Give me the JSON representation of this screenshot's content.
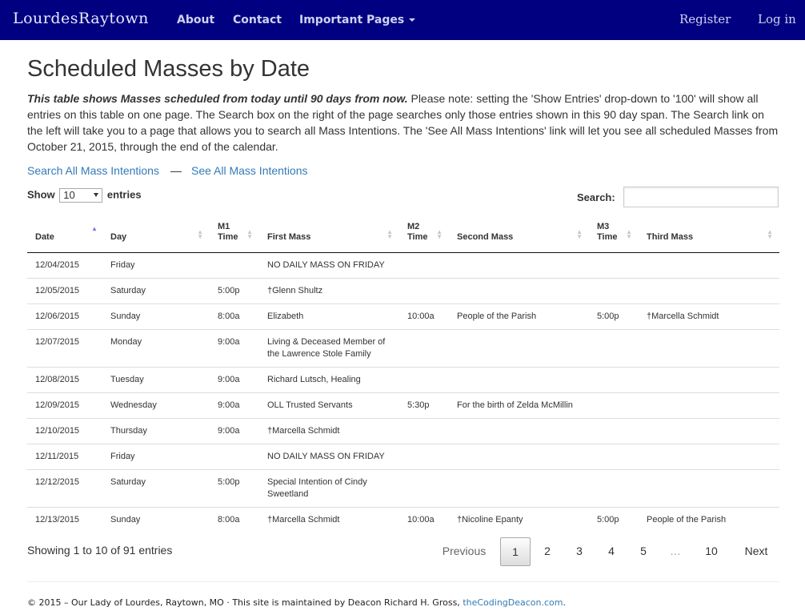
{
  "nav": {
    "brand": "LourdesRaytown",
    "about": "About",
    "contact": "Contact",
    "important": "Important Pages",
    "register": "Register",
    "login": "Log in"
  },
  "page": {
    "title": "Scheduled Masses by Date",
    "intro_bold": "This table shows Masses scheduled from today until 90 days from now.",
    "intro_rest": " Please note: setting the 'Show Entries' drop-down to '100' will show all entries on this table on one page. The Search box on the right of the page searches only those entries shown in this 90 day span. The Search link on the left will take you to a page that allows you to search all Mass Intentions. The 'See All Mass Intentions' link will let you see all scheduled Masses from October 21, 2015, through the end of the calendar.",
    "link_search": "Search All Mass Intentions",
    "link_sep": "—",
    "link_all": "See All Mass Intentions"
  },
  "controls": {
    "show_label": "Show",
    "show_value": "10",
    "entries_label": "entries",
    "search_label": "Search:"
  },
  "table": {
    "headers": {
      "date": "Date",
      "day": "Day",
      "m1": "M1",
      "m1time": "Time",
      "first": "First Mass",
      "m2": "M2",
      "m2time": "Time",
      "second": "Second Mass",
      "m3": "M3",
      "m3time": "Time",
      "third": "Third Mass"
    },
    "rows": [
      [
        "12/04/2015",
        "Friday",
        "",
        "NO DAILY MASS ON FRIDAY",
        "",
        "",
        "",
        ""
      ],
      [
        "12/05/2015",
        "Saturday",
        "5:00p",
        "†Glenn Shultz",
        "",
        "",
        "",
        ""
      ],
      [
        "12/06/2015",
        "Sunday",
        "8:00a",
        "Elizabeth",
        "10:00a",
        "People of the Parish",
        "5:00p",
        "†Marcella Schmidt"
      ],
      [
        "12/07/2015",
        "Monday",
        "9:00a",
        "Living & Deceased Member of the Lawrence Stole Family",
        "",
        "",
        "",
        ""
      ],
      [
        "12/08/2015",
        "Tuesday",
        "9:00a",
        "Richard Lutsch, Healing",
        "",
        "",
        "",
        ""
      ],
      [
        "12/09/2015",
        "Wednesday",
        "9:00a",
        "OLL Trusted Servants",
        "5:30p",
        "For the birth of Zelda McMillin",
        "",
        ""
      ],
      [
        "12/10/2015",
        "Thursday",
        "9:00a",
        "†Marcella Schmidt",
        "",
        "",
        "",
        ""
      ],
      [
        "12/11/2015",
        "Friday",
        "",
        "NO DAILY MASS ON FRIDAY",
        "",
        "",
        "",
        ""
      ],
      [
        "12/12/2015",
        "Saturday",
        "5:00p",
        "Special Intention of Cindy Sweetland",
        "",
        "",
        "",
        ""
      ],
      [
        "12/13/2015",
        "Sunday",
        "8:00a",
        "†Marcella Schmidt",
        "10:00a",
        "†Nicoline Epanty",
        "5:00p",
        "People of the Parish"
      ]
    ]
  },
  "pagination": {
    "info": "Showing 1 to 10 of 91 entries",
    "previous": "Previous",
    "pages": [
      "1",
      "2",
      "3",
      "4",
      "5"
    ],
    "ellipsis": "…",
    "last": "10",
    "next": "Next"
  },
  "footer": {
    "text": "© 2015 – Our Lady of Lourdes, Raytown, MO · This site is maintained by Deacon Richard H. Gross, ",
    "link": "theCodingDeacon.com",
    "end": "."
  }
}
